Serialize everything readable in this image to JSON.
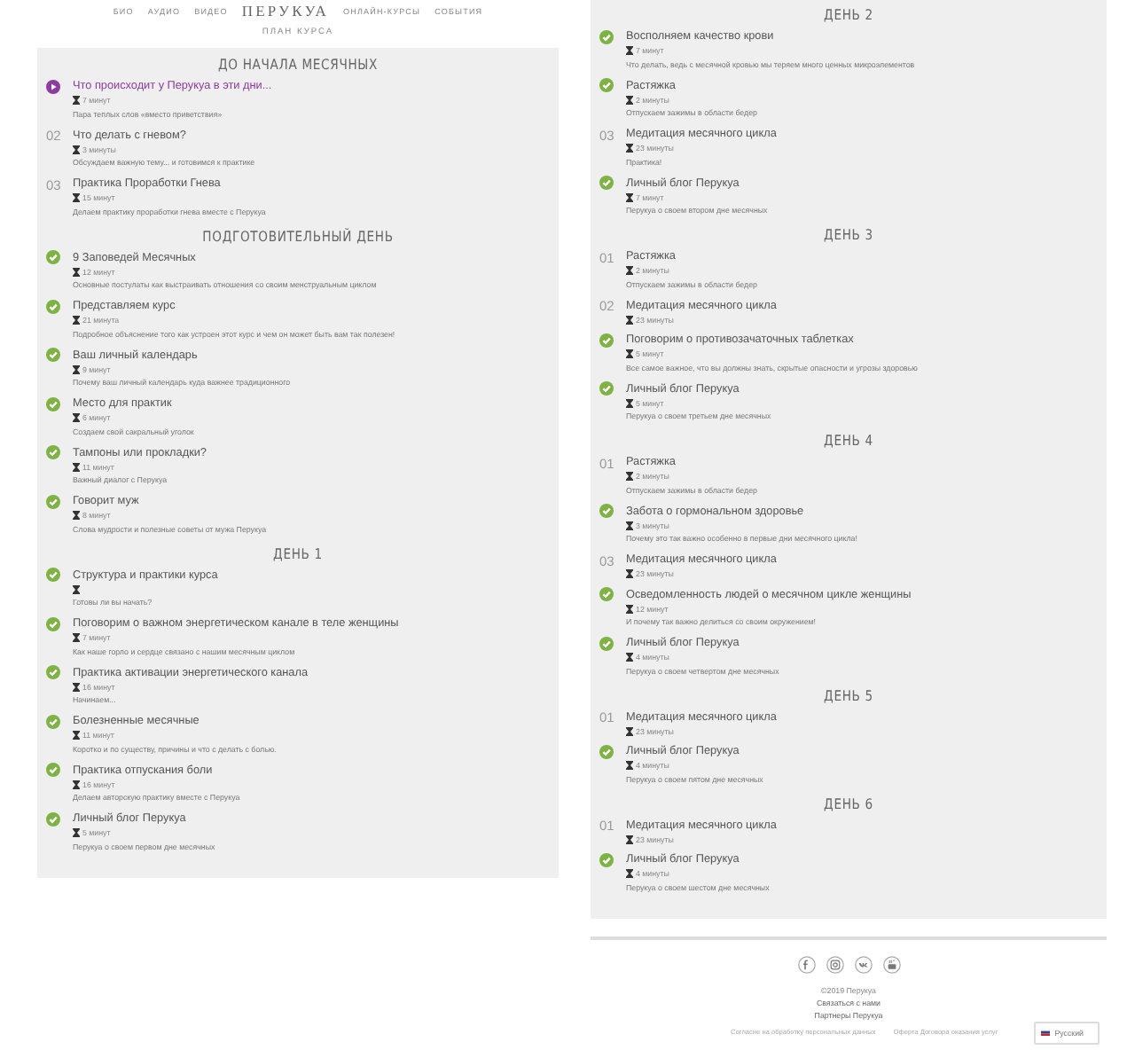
{
  "nav": {
    "items_left": [
      "БИО",
      "АУДИО",
      "ВИДЕО"
    ],
    "logo": "ПЕРУКУА",
    "items_right": [
      "ОНЛАЙН-КУРСЫ",
      "СОБЫТИЯ"
    ]
  },
  "plan_title": "ПЛАН КУРСА",
  "columns": [
    {
      "sections": [
        {
          "title": "ДО НАЧАЛА МЕСЯЧНЫХ",
          "lessons": [
            {
              "kind": "current",
              "title": "Что происходит у Перукуа в эти дни...",
              "duration": "7 минут",
              "description": "Пара теплых слов «вместо приветствия»"
            },
            {
              "kind": "pending",
              "number": "02",
              "title": "Что делать с гневом?",
              "duration": "3 минуты",
              "description": "Обсуждаем важную тему... и готовимся к практике"
            },
            {
              "kind": "pending",
              "number": "03",
              "title": "Практика Проработки Гнева",
              "duration": "15 минут",
              "description": "Делаем практику проработки гнева вместе с Перукуа"
            }
          ]
        },
        {
          "title": "ПОДГОТОВИТЕЛЬНЫЙ ДЕНЬ",
          "lessons": [
            {
              "kind": "done",
              "title": "9 Заповедей Месячных",
              "duration": "12 минут",
              "description": "Основные постулаты как выстраивать отношения со своим менструальным циклом"
            },
            {
              "kind": "done",
              "title": "Представляем курс",
              "duration": "21 минута",
              "description": "Подробное объяснение того как устроен этот курс и чем он может быть вам так полезен!"
            },
            {
              "kind": "done",
              "title": "Ваш личный календарь",
              "duration": "9 минут",
              "description": "Почему ваш личный календарь куда важнее традиционного"
            },
            {
              "kind": "done",
              "title": "Место для практик",
              "duration": "6 минут",
              "description": "Создаем свой сакральный уголок"
            },
            {
              "kind": "done",
              "title": "Тампоны или прокладки?",
              "duration": "11 минут",
              "description": "Важный диалог с Перукуа"
            },
            {
              "kind": "done",
              "title": "Говорит муж",
              "duration": "8 минут",
              "description": "Слова мудрости и полезные советы от мужа Перукуа"
            }
          ]
        },
        {
          "title": "ДЕНЬ 1",
          "lessons": [
            {
              "kind": "done",
              "title": "Структура и практики курса",
              "description": "Готовы ли вы начать?"
            },
            {
              "kind": "done",
              "title": "Поговорим о важном энергетическом канале в теле женщины",
              "duration": "7 минут",
              "description": "Как наше горло и сердце связано с нашим месячным циклом"
            },
            {
              "kind": "done",
              "title": "Практика активации энергетического канала",
              "duration": "16 минут",
              "description": "Начинаем..."
            },
            {
              "kind": "done",
              "title": "Болезненные месячные",
              "duration": "11 минут",
              "description": "Коротко и по существу, причины и что с делать с болью."
            },
            {
              "kind": "done",
              "title": "Практика отпускания боли",
              "duration": "16 минут",
              "description": "Делаем авторскую практику вместе с Перукуа"
            },
            {
              "kind": "done",
              "title": "Личный блог Перукуа",
              "duration": "5 минут",
              "description": "Перукуа о своем первом дне месячных"
            }
          ]
        }
      ]
    },
    {
      "sections": [
        {
          "title": "ДЕНЬ 2",
          "lessons": [
            {
              "kind": "done",
              "title": "Восполняем качество крови",
              "duration": "7 минут",
              "description": "Что делать, ведь с месячной кровью мы теряем много ценных микроэлементов"
            },
            {
              "kind": "done",
              "title": "Растяжка",
              "duration": "2 минуты",
              "description": "Отпускаем зажимы в области бедер"
            },
            {
              "kind": "pending",
              "number": "03",
              "title": "Медитация месячного цикла",
              "duration": "23 минуты",
              "description": "Практика!"
            },
            {
              "kind": "done",
              "title": "Личный блог Перукуа",
              "duration": "7 минут",
              "description": "Перукуа о своем втором дне месячных"
            }
          ]
        },
        {
          "title": "ДЕНЬ 3",
          "lessons": [
            {
              "kind": "pending",
              "number": "01",
              "title": "Растяжка",
              "duration": "2 минуты",
              "description": "Отпускаем зажимы в области бедер"
            },
            {
              "kind": "pending",
              "number": "02",
              "title": "Медитация месячного цикла",
              "duration": "23 минуты"
            },
            {
              "kind": "done",
              "title": "Поговорим о противозачаточных таблетках",
              "duration": "5 минут",
              "description": "Все самое важное, что вы должны знать, скрытые опасности и угрозы здоровью"
            },
            {
              "kind": "done",
              "title": "Личный блог Перукуа",
              "duration": "5 минут",
              "description": "Перукуа о своем третьем дне месячных"
            }
          ]
        },
        {
          "title": "ДЕНЬ 4",
          "lessons": [
            {
              "kind": "pending",
              "number": "01",
              "title": "Растяжка",
              "duration": "2 минуты",
              "description": "Отпускаем зажимы в области бедер"
            },
            {
              "kind": "done",
              "title": "Забота о гормональном здоровье",
              "duration": "3 минуты",
              "description": "Почему это так важно особенно в первые дни месячного цикла!"
            },
            {
              "kind": "pending",
              "number": "03",
              "title": "Медитация месячного цикла",
              "duration": "23 минуты"
            },
            {
              "kind": "done",
              "title": "Осведомленность людей о месячном цикле женщины",
              "duration": "12 минут",
              "description": "И почему так важно делиться со своим окружением!"
            },
            {
              "kind": "done",
              "title": "Личный блог Перукуа",
              "duration": "4 минуты",
              "description": "Перукуа о своем четвертом дне месячных"
            }
          ]
        },
        {
          "title": "ДЕНЬ 5",
          "lessons": [
            {
              "kind": "pending",
              "number": "01",
              "title": "Медитация месячного цикла",
              "duration": "23 минуты"
            },
            {
              "kind": "done",
              "title": "Личный блог Перукуа",
              "duration": "4 минуты",
              "description": "Перукуа о своем пятом дне месячных"
            }
          ]
        },
        {
          "title": "ДЕНЬ 6",
          "lessons": [
            {
              "kind": "pending",
              "number": "01",
              "title": "Медитация месячного цикла",
              "duration": "23 минуты"
            },
            {
              "kind": "done",
              "title": "Личный блог Перукуа",
              "duration": "4 минуты",
              "description": "Перукуа о своем шестом дне месячных"
            }
          ]
        }
      ]
    }
  ],
  "footer": {
    "social": [
      {
        "kind": "facebook"
      },
      {
        "kind": "instagram"
      },
      {
        "kind": "vk"
      },
      {
        "kind": "youtube"
      }
    ],
    "lines": [
      "©2019 Перукуа",
      "Связаться с нами",
      "Партнеры Перукуа"
    ],
    "legal_links": [
      "Согласие на обработку персональных данных",
      "Оферта Договора оказания услуг"
    ],
    "language": "Русский"
  }
}
